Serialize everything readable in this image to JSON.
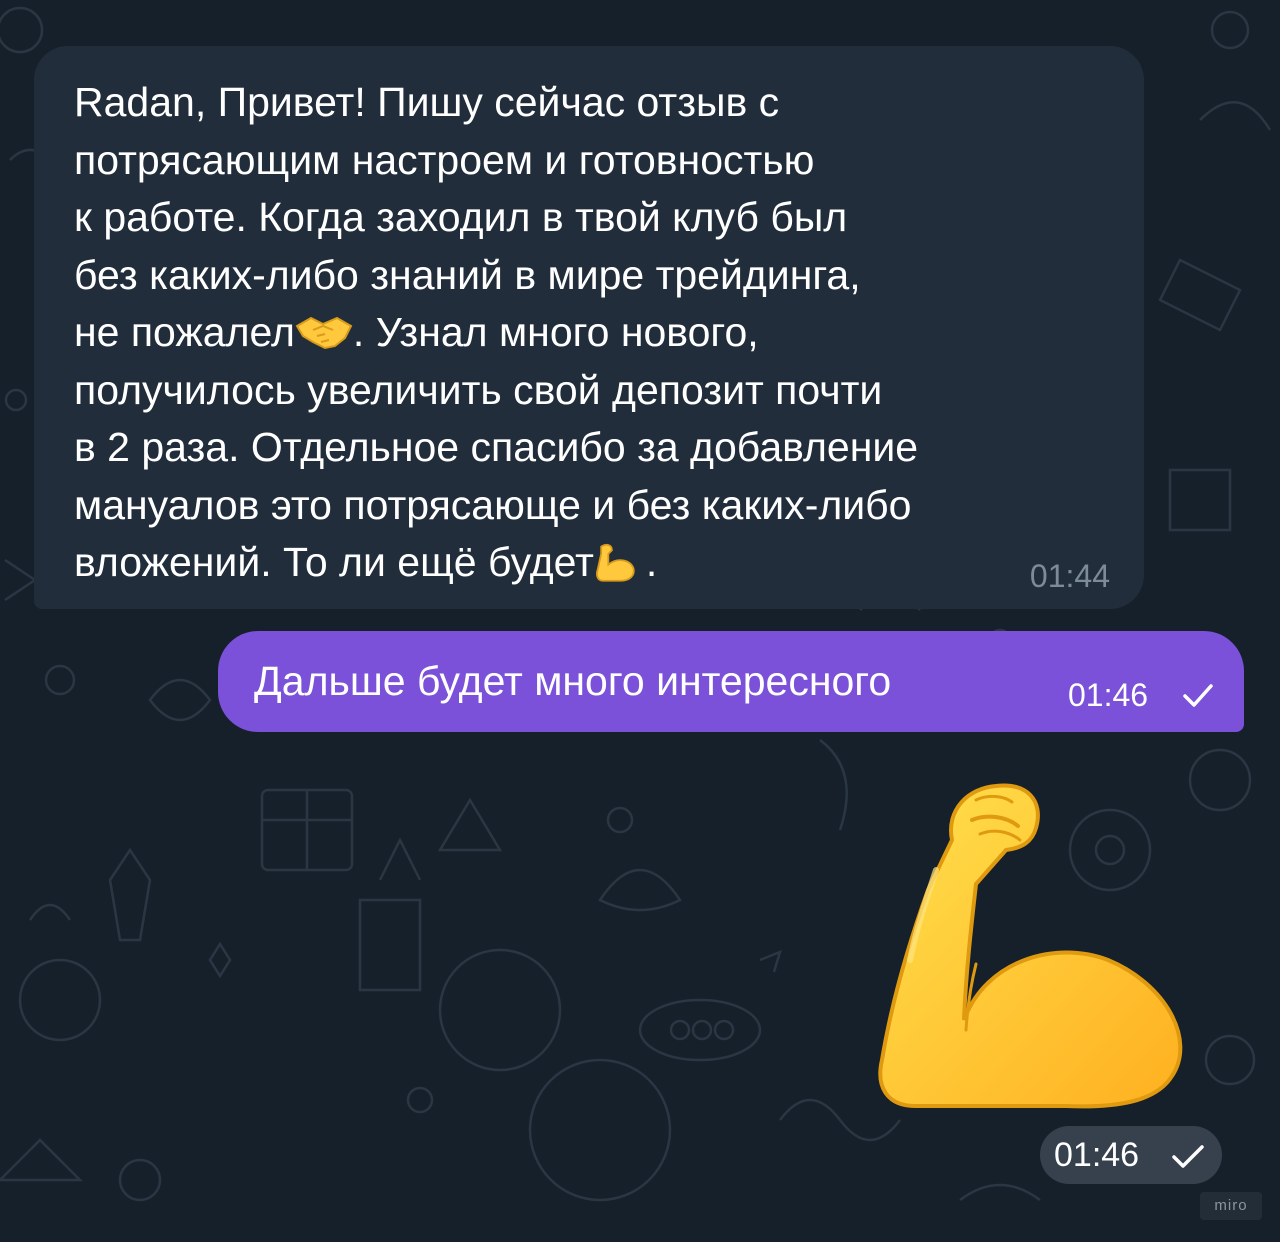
{
  "messages": {
    "incoming": {
      "text_part1": "Radan, Привет! Пишу сейчас отзыв с\nпотрясающим настроем и готовностью\nк работе. Когда заходил в твой клуб был\nбез каких-либо знаний в мире трейдинга,\nне пожалел",
      "emoji1": "handshake-emoji",
      "text_part2": ". Узнал много нового,\nполучилось увеличить свой депозит почти\nв 2 раза. Отдельное спасибо за добавление\nмануалов это потрясающе и без каких-либо\nвложений. То ли ещё будет",
      "emoji2": "flexed-biceps-emoji",
      "text_part3": ".",
      "time": "01:44"
    },
    "outgoing": {
      "text": "Дальше будет много интересного",
      "time": "01:46",
      "status": "sent"
    },
    "sticker": {
      "icon": "flexed-biceps-sticker",
      "time": "01:46",
      "status": "sent"
    }
  },
  "watermark": "miro",
  "colors": {
    "background": "#16202b",
    "incoming_bubble": "#212d3b",
    "outgoing_bubble": "#7a51d8",
    "emoji_yellow": "#ffc83d"
  }
}
